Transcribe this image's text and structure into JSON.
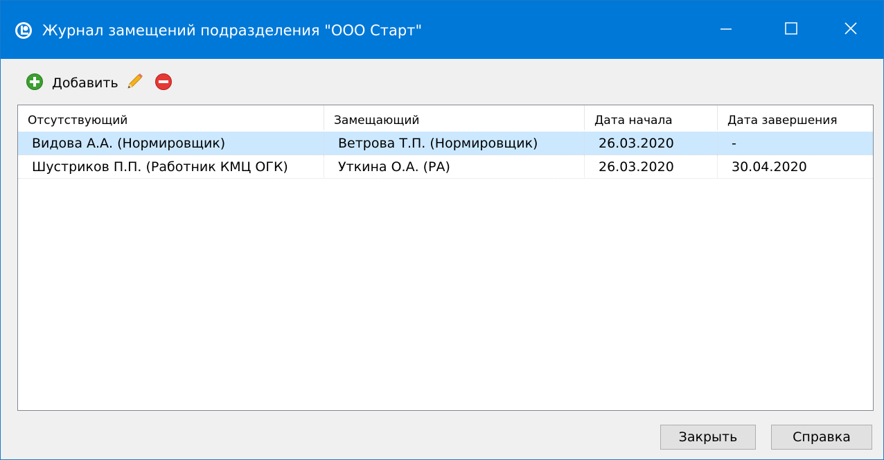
{
  "window": {
    "title": "Журнал замещений подразделения \"ООО Старт\"",
    "accent_color": "#0078d7"
  },
  "titlebar_buttons": {
    "minimize_icon": "minimize-icon",
    "maximize_icon": "maximize-icon",
    "close_icon": "close-icon"
  },
  "toolbar": {
    "add_label": "Добавить",
    "add_icon": "plus-circle-icon",
    "edit_icon": "pencil-icon",
    "delete_icon": "minus-circle-icon"
  },
  "table": {
    "columns": [
      "Отсутствующий",
      "Замещающий",
      "Дата начала",
      "Дата завершения"
    ],
    "rows": [
      {
        "absent": "Видова А.А. (Нормировщик)",
        "substitute": "Ветрова Т.П. (Нормировщик)",
        "start": "26.03.2020",
        "end": "-",
        "selected": true
      },
      {
        "absent": "Шустриков П.П. (Работник КМЦ ОГК)",
        "substitute": "Уткина О.А. (РА)",
        "start": "26.03.2020",
        "end": "30.04.2020",
        "selected": false
      }
    ]
  },
  "footer": {
    "close_label": "Закрыть",
    "help_label": "Справка"
  }
}
